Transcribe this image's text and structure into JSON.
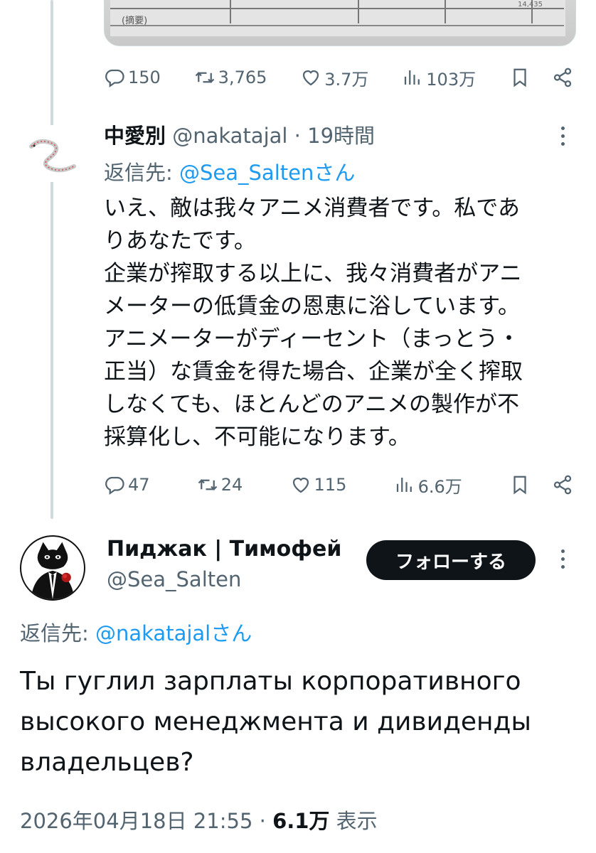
{
  "top_tweet": {
    "photo": {
      "caption": "(摘要)",
      "number": "14,435"
    },
    "actions": {
      "replies": "150",
      "retweets": "3,765",
      "likes": "3.7万",
      "views": "103万"
    }
  },
  "reply_tweet": {
    "display_name": "中愛別",
    "handle_time": "@nakatajal · 19時間",
    "reply_prefix": "返信先:",
    "reply_mention": "@Sea_Salten",
    "reply_suffix": "さん",
    "body_lines": [
      "いえ、敵は我々アニメ消費者です。私であ",
      "りあなたです。",
      "企業が搾取する以上に、我々消費者がアニ",
      "メーターの低賃金の恩恵に浴しています。",
      "アニメーターがディーセント（まっとう・",
      "正当）な賃金を得た場合、企業が全く搾取",
      "しなくても、ほとんどのアニメの製作が不",
      "採算化し、不可能になります。"
    ],
    "actions": {
      "replies": "47",
      "retweets": "24",
      "likes": "115",
      "views": "6.6万"
    }
  },
  "main_tweet": {
    "display_name": "Пиджак | Тимофей",
    "handle": "@Sea_Salten",
    "follow_label": "フォローする",
    "reply_prefix": "返信先:",
    "reply_mention": "@nakatajal",
    "reply_suffix": "さん",
    "body_lines": [
      "Ты гуглил зарплаты корпоративного",
      "высокого менеджмента и дивиденды",
      "владельцев?"
    ],
    "timestamp": "2026年04月18日 21:55",
    "separator": " · ",
    "views_count": "6.1万",
    "views_label": " 表示"
  },
  "icons": [
    "reply-icon",
    "retweet-icon",
    "like-icon",
    "views-icon",
    "bookmark-icon",
    "share-icon",
    "more-icon"
  ],
  "colors": {
    "text": "#0f1419",
    "muted": "#536471",
    "link": "#1d9bf0",
    "thread_line": "#cfd9de",
    "follow_bg": "#0f1419"
  }
}
